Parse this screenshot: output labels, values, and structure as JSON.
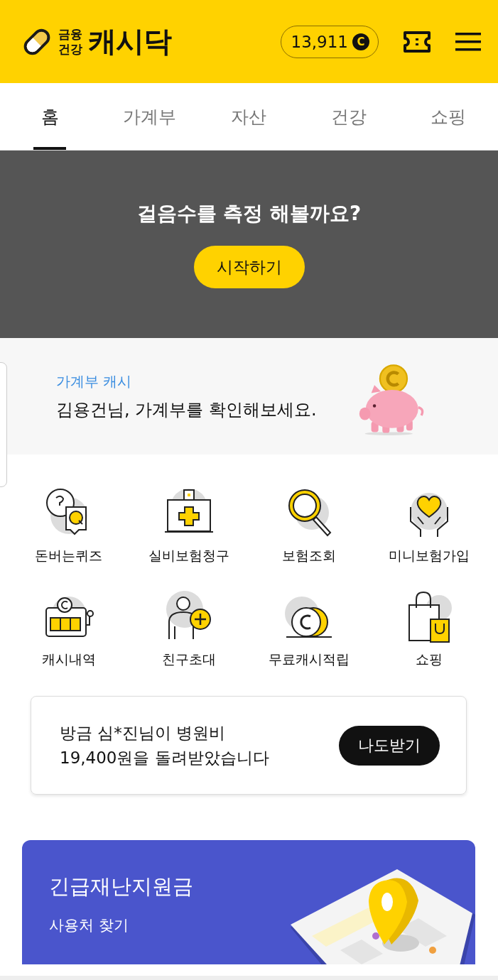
{
  "header": {
    "logo_small": [
      "금융",
      "건강"
    ],
    "logo_name": "캐시닥",
    "cash_balance": "13,911",
    "coin_symbol": "C"
  },
  "tabs": [
    {
      "label": "홈",
      "selected": true
    },
    {
      "label": "가계부",
      "selected": false
    },
    {
      "label": "자산",
      "selected": false
    },
    {
      "label": "건강",
      "selected": false
    },
    {
      "label": "쇼핑",
      "selected": false
    }
  ],
  "steps_banner": {
    "title": "걸음수를 측정 해볼까요?",
    "button": "시작하기"
  },
  "ledger_promo": {
    "label": "가계부 캐시",
    "text": "김용건님, 가계부를 확인해보세요."
  },
  "menu": [
    {
      "label": "돈버는퀴즈"
    },
    {
      "label": "실비보험청구"
    },
    {
      "label": "보험조회"
    },
    {
      "label": "미니보험가입"
    },
    {
      "label": "캐시내역"
    },
    {
      "label": "친구초대"
    },
    {
      "label": "무료캐시적립"
    },
    {
      "label": "쇼핑"
    }
  ],
  "notice": {
    "lines": [
      "방금 심*진님이 병원비",
      "19,400원을 돌려받았습니다"
    ],
    "button": "나도받기"
  },
  "relief_card": {
    "title": "긴급재난지원금",
    "subtitle": "사용처 찾기"
  }
}
